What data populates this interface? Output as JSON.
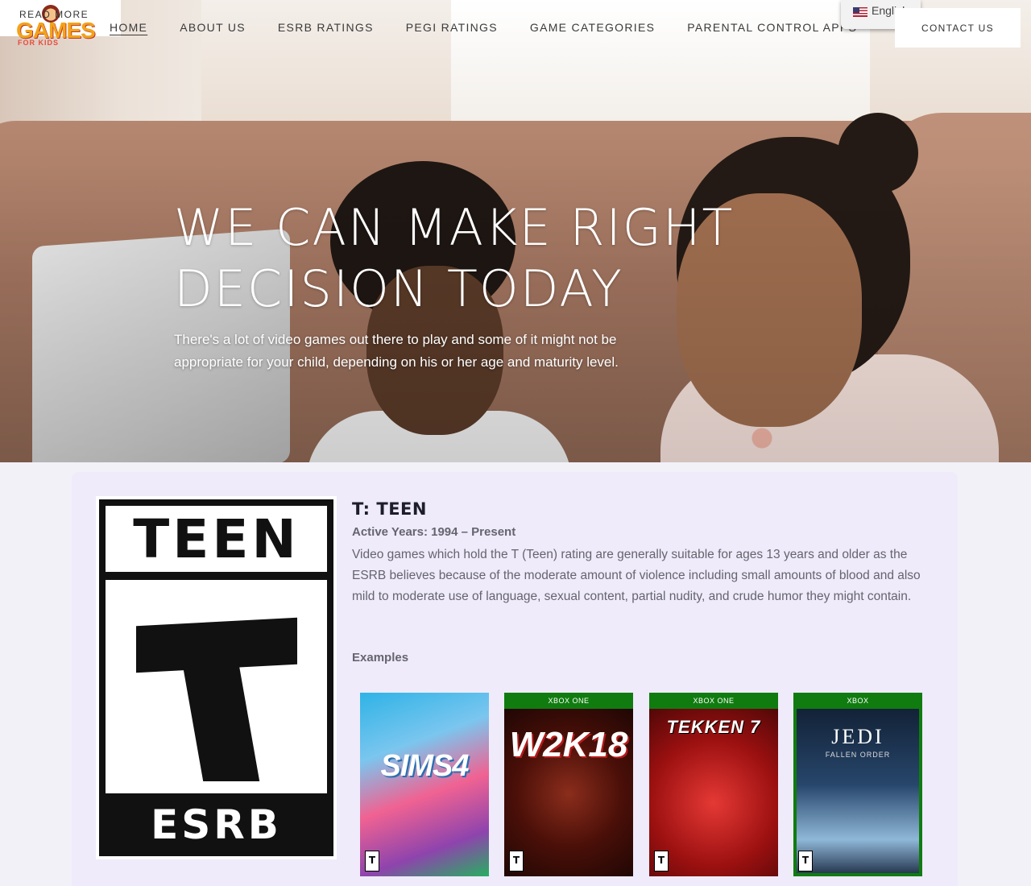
{
  "header": {
    "logo_text": "GAMES",
    "logo_sub": "FOR KIDS",
    "read_more": "READ MORE",
    "nav": [
      {
        "label": "HOME"
      },
      {
        "label": "ABOUT US"
      },
      {
        "label": "ESRB RATINGS"
      },
      {
        "label": "PEGI RATINGS"
      },
      {
        "label": "GAME CATEGORIES"
      },
      {
        "label": "PARENTAL CONTROL APPS"
      }
    ],
    "language": "English",
    "language_icon": "us-flag-icon",
    "contact_label": "CONTACT US"
  },
  "hero": {
    "title": "WE CAN MAKE RIGHT DECISION TODAY",
    "subtitle": "There's a lot of video games out there to play and some of it might not be appropriate for your child, depending on his or her age and maturity level."
  },
  "rating": {
    "logo_top": "TEEN",
    "logo_letter": "T",
    "logo_bottom": "ESRB",
    "title": "T: TEEN",
    "active_years": "Active Years: 1994 – Present",
    "description": "Video games which hold the T (Teen) rating are generally suitable for ages 13 years and older as the ESRB believes because of the moderate amount of violence including small amounts of blood and also mild to moderate use of language, sexual content, partial nudity, and crude humor they might contain.",
    "examples_label": "Examples",
    "examples": [
      {
        "title": "SIMS4",
        "platform": ""
      },
      {
        "title": "W2K18",
        "platform": "XBOX ONE"
      },
      {
        "title": "TEKKEN 7",
        "platform": "XBOX ONE"
      },
      {
        "title": "JEDI",
        "subtitle": "FALLEN ORDER",
        "platform": "XBOX"
      }
    ]
  },
  "colors": {
    "card_bg": "#efebfb",
    "xbox_green": "#107c10",
    "text_muted": "#66646e"
  }
}
